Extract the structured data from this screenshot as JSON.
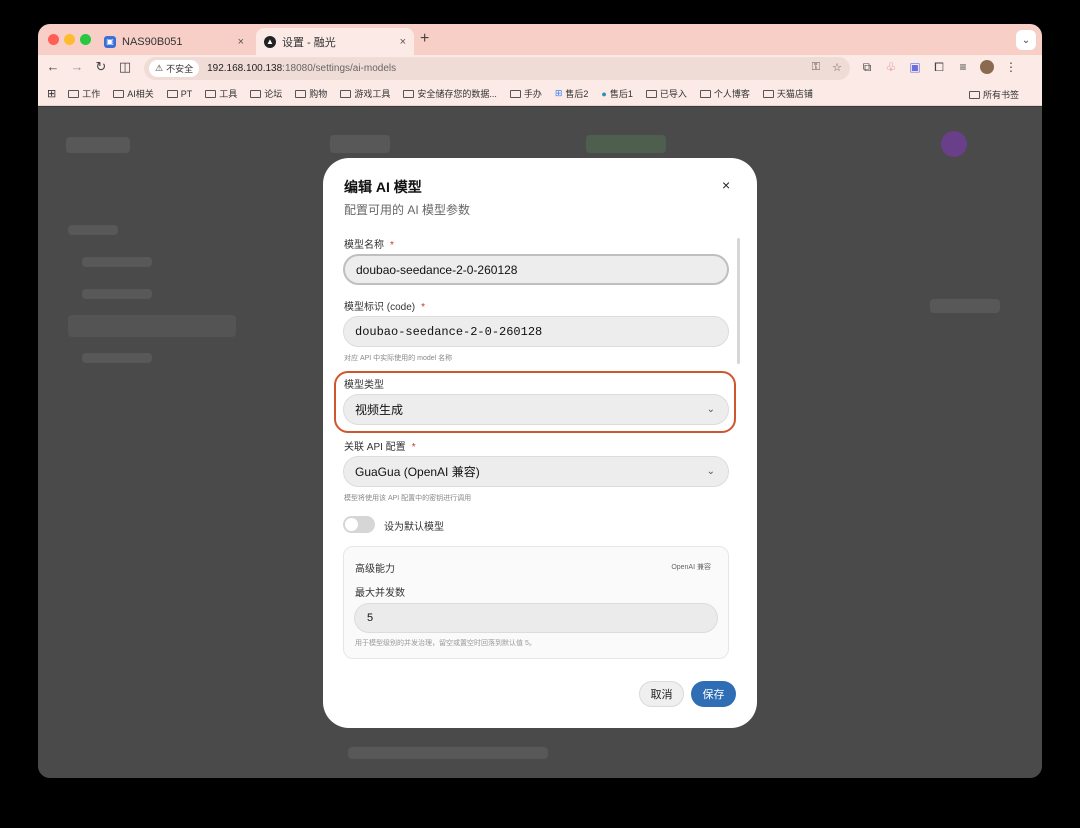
{
  "browser": {
    "tabs": [
      {
        "label": "NAS90B051",
        "close": "×"
      },
      {
        "label": "设置 - 融光",
        "close": "×"
      }
    ],
    "new_tab": "+",
    "tab_menu": "⌄",
    "security_label": "不安全",
    "url_host": "192.168.100.138",
    "url_path": ":18080/settings/ai-models",
    "bookmarks": [
      "工作",
      "AI相关",
      "PT",
      "工具",
      "论坛",
      "购物",
      "游戏工具",
      "安全储存您的数据...",
      "手办",
      "售后2",
      "售后1",
      "已导入",
      "个人博客",
      "天猫店铺"
    ],
    "bookmarks_right": "所有书签"
  },
  "modal": {
    "title": "编辑 AI 模型",
    "subtitle": "配置可用的 AI 模型参数",
    "close": "×",
    "name_label": "模型名称",
    "required_mark": "*",
    "name_value": "doubao-seedance-2-0-260128",
    "code_label": "模型标识 (code)",
    "code_value": "doubao-seedance-2-0-260128",
    "code_hint": "对应 API 中实际使用的 model 名称",
    "type_label": "模型类型",
    "type_value": "视频生成",
    "api_label": "关联 API 配置",
    "api_value": "GuaGua (OpenAI 兼容)",
    "api_hint": "模型将使用该 API 配置中的密钥进行调用",
    "default_toggle_label": "设为默认模型",
    "default_toggle_on": false,
    "advanced": {
      "title": "高级能力",
      "badge": "OpenAI 兼容",
      "concurrency_label": "最大并发数",
      "concurrency_value": "5",
      "concurrency_hint": "用于模型级别的并发治理，留空或置空时回落到默认值 5。"
    },
    "cancel_label": "取消",
    "save_label": "保存"
  },
  "colors": {
    "highlight": "#d0562f",
    "save_button": "#2f6eb5",
    "required": "#c0392b"
  }
}
